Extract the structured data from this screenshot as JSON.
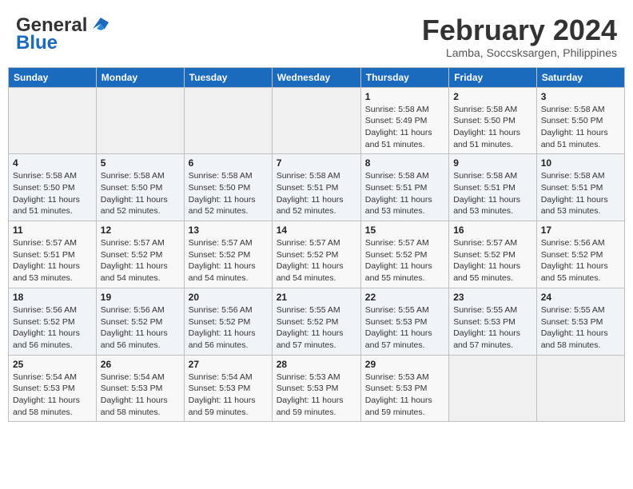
{
  "logo": {
    "general": "General",
    "blue": "Blue"
  },
  "header": {
    "title": "February 2024",
    "subtitle": "Lamba, Soccsksargen, Philippines"
  },
  "weekdays": [
    "Sunday",
    "Monday",
    "Tuesday",
    "Wednesday",
    "Thursday",
    "Friday",
    "Saturday"
  ],
  "weeks": [
    [
      {
        "day": "",
        "info": ""
      },
      {
        "day": "",
        "info": ""
      },
      {
        "day": "",
        "info": ""
      },
      {
        "day": "",
        "info": ""
      },
      {
        "day": "1",
        "sunrise": "5:58 AM",
        "sunset": "5:49 PM",
        "daylight": "11 hours and 51 minutes."
      },
      {
        "day": "2",
        "sunrise": "5:58 AM",
        "sunset": "5:50 PM",
        "daylight": "11 hours and 51 minutes."
      },
      {
        "day": "3",
        "sunrise": "5:58 AM",
        "sunset": "5:50 PM",
        "daylight": "11 hours and 51 minutes."
      }
    ],
    [
      {
        "day": "4",
        "sunrise": "5:58 AM",
        "sunset": "5:50 PM",
        "daylight": "11 hours and 51 minutes."
      },
      {
        "day": "5",
        "sunrise": "5:58 AM",
        "sunset": "5:50 PM",
        "daylight": "11 hours and 52 minutes."
      },
      {
        "day": "6",
        "sunrise": "5:58 AM",
        "sunset": "5:50 PM",
        "daylight": "11 hours and 52 minutes."
      },
      {
        "day": "7",
        "sunrise": "5:58 AM",
        "sunset": "5:51 PM",
        "daylight": "11 hours and 52 minutes."
      },
      {
        "day": "8",
        "sunrise": "5:58 AM",
        "sunset": "5:51 PM",
        "daylight": "11 hours and 53 minutes."
      },
      {
        "day": "9",
        "sunrise": "5:58 AM",
        "sunset": "5:51 PM",
        "daylight": "11 hours and 53 minutes."
      },
      {
        "day": "10",
        "sunrise": "5:58 AM",
        "sunset": "5:51 PM",
        "daylight": "11 hours and 53 minutes."
      }
    ],
    [
      {
        "day": "11",
        "sunrise": "5:57 AM",
        "sunset": "5:51 PM",
        "daylight": "11 hours and 53 minutes."
      },
      {
        "day": "12",
        "sunrise": "5:57 AM",
        "sunset": "5:52 PM",
        "daylight": "11 hours and 54 minutes."
      },
      {
        "day": "13",
        "sunrise": "5:57 AM",
        "sunset": "5:52 PM",
        "daylight": "11 hours and 54 minutes."
      },
      {
        "day": "14",
        "sunrise": "5:57 AM",
        "sunset": "5:52 PM",
        "daylight": "11 hours and 54 minutes."
      },
      {
        "day": "15",
        "sunrise": "5:57 AM",
        "sunset": "5:52 PM",
        "daylight": "11 hours and 55 minutes."
      },
      {
        "day": "16",
        "sunrise": "5:57 AM",
        "sunset": "5:52 PM",
        "daylight": "11 hours and 55 minutes."
      },
      {
        "day": "17",
        "sunrise": "5:56 AM",
        "sunset": "5:52 PM",
        "daylight": "11 hours and 55 minutes."
      }
    ],
    [
      {
        "day": "18",
        "sunrise": "5:56 AM",
        "sunset": "5:52 PM",
        "daylight": "11 hours and 56 minutes."
      },
      {
        "day": "19",
        "sunrise": "5:56 AM",
        "sunset": "5:52 PM",
        "daylight": "11 hours and 56 minutes."
      },
      {
        "day": "20",
        "sunrise": "5:56 AM",
        "sunset": "5:52 PM",
        "daylight": "11 hours and 56 minutes."
      },
      {
        "day": "21",
        "sunrise": "5:55 AM",
        "sunset": "5:52 PM",
        "daylight": "11 hours and 57 minutes."
      },
      {
        "day": "22",
        "sunrise": "5:55 AM",
        "sunset": "5:53 PM",
        "daylight": "11 hours and 57 minutes."
      },
      {
        "day": "23",
        "sunrise": "5:55 AM",
        "sunset": "5:53 PM",
        "daylight": "11 hours and 57 minutes."
      },
      {
        "day": "24",
        "sunrise": "5:55 AM",
        "sunset": "5:53 PM",
        "daylight": "11 hours and 58 minutes."
      }
    ],
    [
      {
        "day": "25",
        "sunrise": "5:54 AM",
        "sunset": "5:53 PM",
        "daylight": "11 hours and 58 minutes."
      },
      {
        "day": "26",
        "sunrise": "5:54 AM",
        "sunset": "5:53 PM",
        "daylight": "11 hours and 58 minutes."
      },
      {
        "day": "27",
        "sunrise": "5:54 AM",
        "sunset": "5:53 PM",
        "daylight": "11 hours and 59 minutes."
      },
      {
        "day": "28",
        "sunrise": "5:53 AM",
        "sunset": "5:53 PM",
        "daylight": "11 hours and 59 minutes."
      },
      {
        "day": "29",
        "sunrise": "5:53 AM",
        "sunset": "5:53 PM",
        "daylight": "11 hours and 59 minutes."
      },
      {
        "day": "",
        "info": ""
      },
      {
        "day": "",
        "info": ""
      }
    ]
  ]
}
